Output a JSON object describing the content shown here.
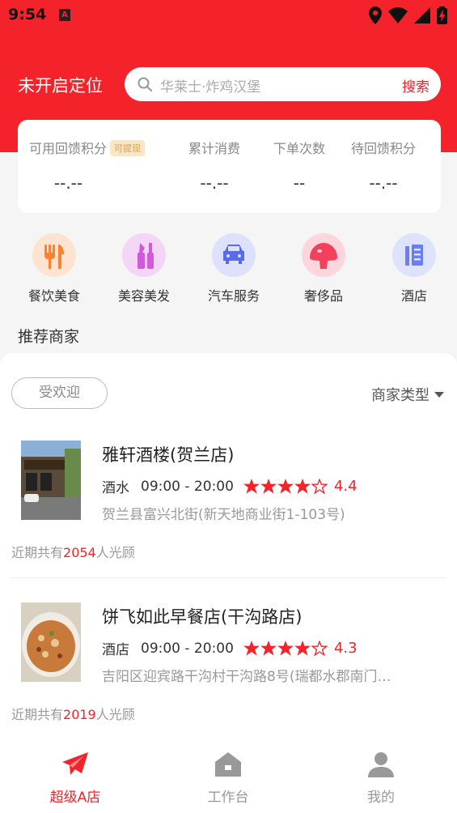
{
  "status_bar": {
    "time": "9:54",
    "a_icon": "A"
  },
  "header": {
    "location_text": "未开启定位",
    "search_placeholder": "华莱士·炸鸡汉堡",
    "search_button": "搜索"
  },
  "stats": [
    {
      "label": "可用回馈积分",
      "badge": "可提现",
      "value": "--.--"
    },
    {
      "label": "累计消费",
      "value": "--.--"
    },
    {
      "label": "下单次数",
      "value": "--"
    },
    {
      "label": "待回馈积分",
      "value": "--.--"
    }
  ],
  "categories": [
    {
      "label": "餐饮美食",
      "icon": "utensils-icon",
      "color": "#fa8230"
    },
    {
      "label": "美容美发",
      "icon": "cosmetics-icon",
      "color": "#d05ad8"
    },
    {
      "label": "汽车服务",
      "icon": "car-icon",
      "color": "#5a6be8"
    },
    {
      "label": "奢侈品",
      "icon": "mushroom-icon",
      "color": "#f4405a"
    },
    {
      "label": "酒店",
      "icon": "building-icon",
      "color": "#6a7ef0"
    }
  ],
  "section_title": "推荐商家",
  "filters": {
    "popular": "受欢迎",
    "merchant_type": "商家类型"
  },
  "merchants": [
    {
      "name": "雅轩酒楼(贺兰店)",
      "type": "酒水",
      "hours": "09:00 - 20:00",
      "rating": "4.4",
      "stars": 4,
      "address": "贺兰县富兴北街(新天地商业街1-103号)",
      "visits_prefix": "近期共有",
      "visits": "2054",
      "visits_suffix": "人光顾"
    },
    {
      "name": "饼飞如此早餐店(干沟路店)",
      "type": "酒店",
      "hours": "09:00 - 20:00",
      "rating": "4.3",
      "stars": 4,
      "address": "吉阳区迎宾路干沟村干沟路8号(瑞都水郡南门…",
      "visits_prefix": "近期共有",
      "visits": "2019",
      "visits_suffix": "人光顾"
    }
  ],
  "bottom_nav": [
    {
      "label": "超级A店",
      "icon": "paper-plane-icon",
      "active": true
    },
    {
      "label": "工作台",
      "icon": "home-icon",
      "active": false
    },
    {
      "label": "我的",
      "icon": "user-icon",
      "active": false
    }
  ],
  "colors": {
    "brand": "#f4222b",
    "badge_bg": "#f8e6c6",
    "badge_text": "#d8a050"
  }
}
